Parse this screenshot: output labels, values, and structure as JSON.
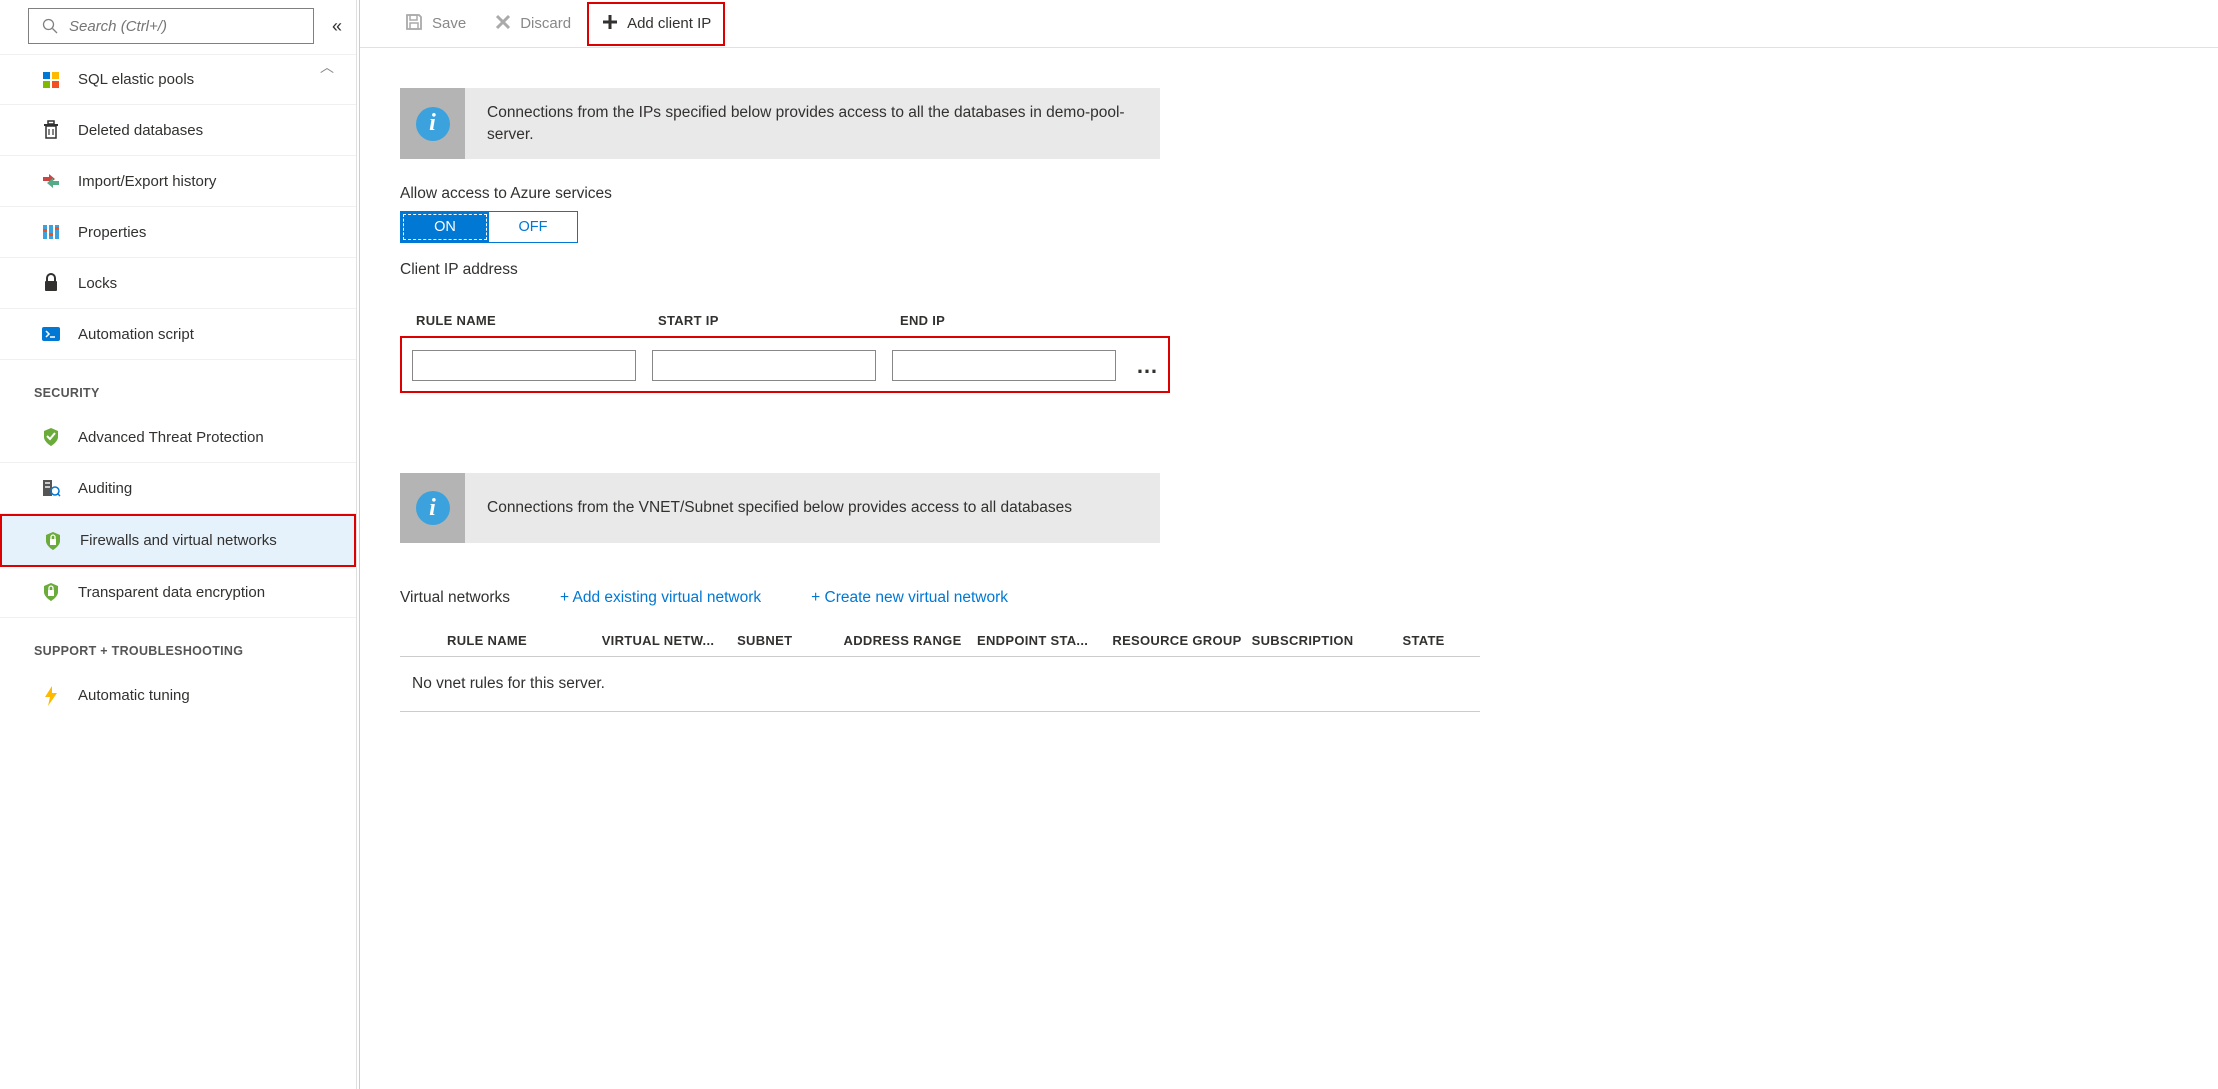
{
  "sidebar": {
    "search_placeholder": "Search (Ctrl+/)",
    "items_top": [
      {
        "id": "sql-elastic-pools",
        "label": "SQL elastic pools",
        "icon": "elastic-pools-icon"
      },
      {
        "id": "deleted-databases",
        "label": "Deleted databases",
        "icon": "trash-icon"
      },
      {
        "id": "import-export-history",
        "label": "Import/Export history",
        "icon": "import-export-icon"
      },
      {
        "id": "properties",
        "label": "Properties",
        "icon": "properties-icon"
      },
      {
        "id": "locks",
        "label": "Locks",
        "icon": "lock-icon"
      },
      {
        "id": "automation-script",
        "label": "Automation script",
        "icon": "script-icon"
      }
    ],
    "section_security": "SECURITY",
    "items_security": [
      {
        "id": "advanced-threat-protection",
        "label": "Advanced Threat Protection",
        "icon": "shield-check-icon"
      },
      {
        "id": "auditing",
        "label": "Auditing",
        "icon": "auditing-icon"
      },
      {
        "id": "firewalls-and-virtual-networks",
        "label": "Firewalls and virtual networks",
        "icon": "shield-lock-icon",
        "selected": true
      },
      {
        "id": "transparent-data-encryption",
        "label": "Transparent data encryption",
        "icon": "shield-lock-icon"
      }
    ],
    "section_support": "SUPPORT + TROUBLESHOOTING",
    "items_support": [
      {
        "id": "automatic-tuning",
        "label": "Automatic tuning",
        "icon": "bolt-icon"
      }
    ]
  },
  "toolbar": {
    "save": "Save",
    "discard": "Discard",
    "add_client_ip": "Add client IP"
  },
  "main": {
    "info1": "Connections from the IPs specified below provides access to all the databases in demo-pool-server.",
    "allow_label": "Allow access to Azure services",
    "toggle_on": "ON",
    "toggle_off": "OFF",
    "client_ip_label": "Client IP address",
    "fw_headers": {
      "rule": "RULE NAME",
      "start": "START IP",
      "end": "END IP"
    },
    "info2": "Connections from the VNET/Subnet specified below provides access to all databases",
    "vnet_section": "Virtual networks",
    "add_existing": "+ Add existing virtual network",
    "create_new": "+ Create new virtual network",
    "vnet_headers": {
      "rule": "RULE NAME",
      "vnet": "VIRTUAL NETW...",
      "subnet": "SUBNET",
      "addr": "ADDRESS RANGE",
      "endpoint": "ENDPOINT STA...",
      "rg": "RESOURCE GROUP",
      "subscription": "SUBSCRIPTION",
      "state": "STATE"
    },
    "vnet_empty": "No vnet rules for this server."
  }
}
